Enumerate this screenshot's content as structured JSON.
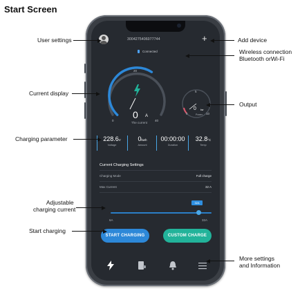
{
  "page_title": "Start Screen",
  "callouts": {
    "user_settings": "User settings",
    "add_device": "Add device",
    "wireless_line1": "Wireless connection",
    "wireless_line2": "Bluetooth orWi-Fi",
    "current_display": "Current display",
    "output": "Output",
    "charging_parameter": "Charging parameter",
    "adjustable_line1": "Adjustable",
    "adjustable_line2": "charging current",
    "start_charging": "Start charging",
    "more_line1": "More settings",
    "more_line2": "and Information"
  },
  "app": {
    "device_id": "3004275406077744",
    "add_symbol": "+",
    "connection_status": "Connected",
    "current_gauge": {
      "scale_min": "0",
      "scale_mid": "20",
      "scale_max": "40",
      "value": "0",
      "unit": "A",
      "label": "The current",
      "fill_fraction": 0.62
    },
    "power_gauge": {
      "scale_min": "0",
      "scale_top": "5",
      "scale_max": "10",
      "value": "0",
      "unit": "kw",
      "label": "Power"
    },
    "params": [
      {
        "value": "228.6",
        "unit": "V",
        "label": "Voltage"
      },
      {
        "value": "0",
        "unit": "kwh",
        "label": "Amount"
      },
      {
        "value": "00:00:00",
        "unit": "",
        "label": "Duration"
      },
      {
        "value": "32.8",
        "unit": "°C",
        "label": "Temp"
      }
    ],
    "settings": {
      "title": "Current Charging Settings",
      "mode_label": "Charging Mode",
      "mode_value": "Full charge",
      "max_label": "Max Current",
      "max_value": "32 A"
    },
    "slider": {
      "min_label": "6A",
      "max_label": "32A",
      "bubble": "32A",
      "fraction": 0.92
    },
    "buttons": {
      "start": "START CHARGING",
      "custom": "CUSTOM CHARGE"
    },
    "tabs": [
      "lightning-icon",
      "charger-icon",
      "bell-icon",
      "menu-icon"
    ],
    "colors": {
      "accent_blue": "#2d88d8",
      "accent_teal": "#22b39a",
      "screen_bg": "#262a30"
    }
  }
}
